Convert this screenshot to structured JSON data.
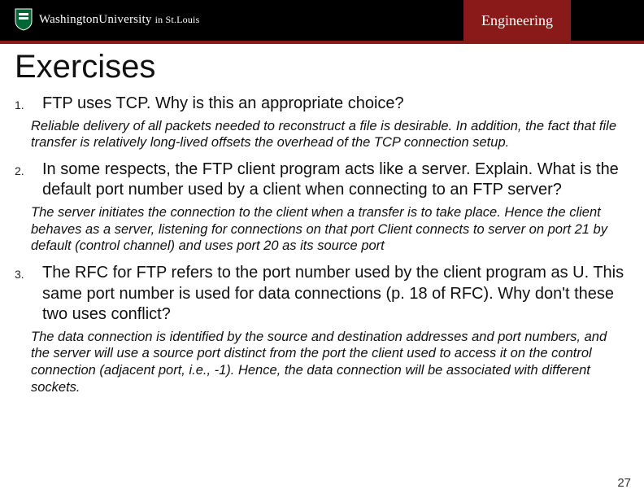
{
  "header": {
    "logo_text_html": "WashingtonUniversity in St.Louis",
    "logo_prefix": "Washington",
    "logo_univ": "University ",
    "logo_in": "in ",
    "logo_place": "St.Louis",
    "engineering": "Engineering"
  },
  "title": "Exercises",
  "items": [
    {
      "num": "1.",
      "question": "FTP uses TCP. Why is this an appropriate choice?",
      "answer": "Reliable delivery of all packets needed to reconstruct a file is desirable.  In addition, the fact that file transfer is relatively long-lived offsets the overhead of the TCP connection setup."
    },
    {
      "num": "2.",
      "question": "In some respects, the FTP client program acts like a server. Explain. What is the default port number used by a client when connecting to an FTP server?",
      "answer": "The server initiates the connection to the client when a transfer is to take place. Hence the client behaves as a server, listening for connections on that port Client connects to server on port 21 by default (control channel) and uses port 20 as its source port"
    },
    {
      "num": "3.",
      "question": "The RFC for FTP refers to the port number used by the client program as U. This same port number is used for data connections (p. 18 of RFC). Why don't these two uses conflict?",
      "answer": "The data connection is identified by the source and destination addresses and port numbers, and the server will use a source port distinct from the port the client used to access it on the control connection (adjacent port, i.e., -1). Hence, the data connection will be associated with different sockets."
    }
  ],
  "page_number": "27"
}
